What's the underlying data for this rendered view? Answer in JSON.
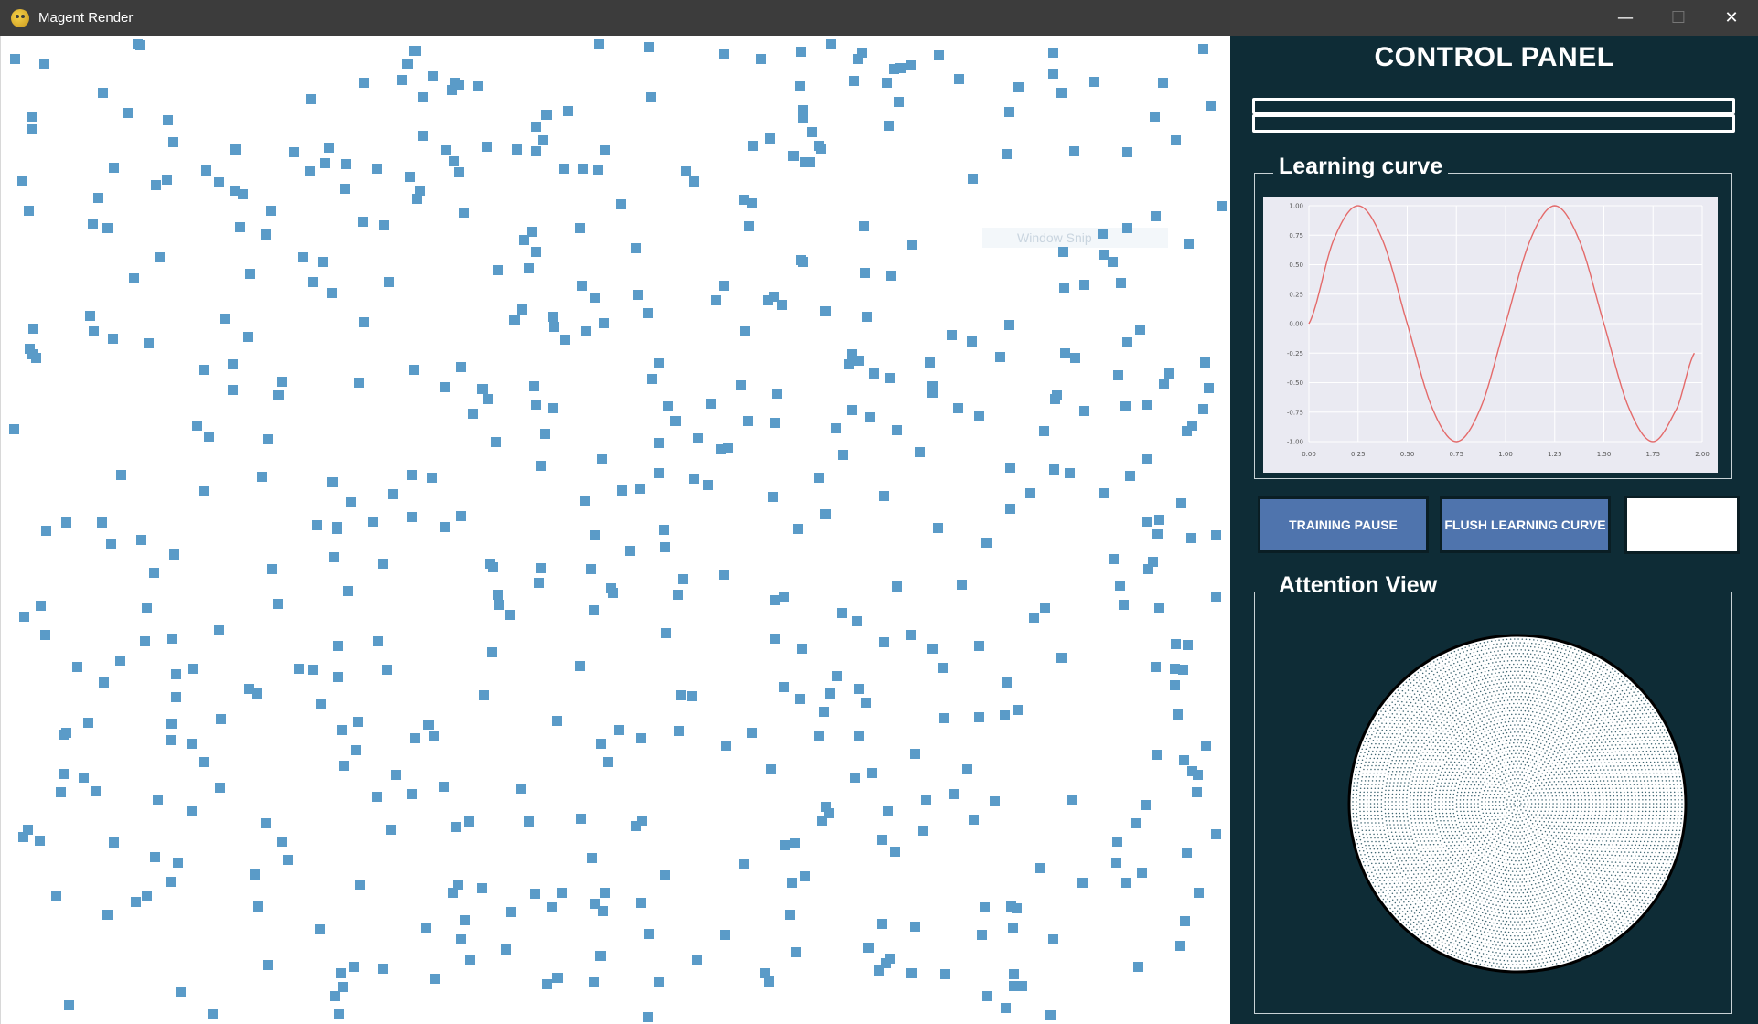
{
  "window": {
    "title": "Magent Render",
    "controls": {
      "minimize": "—",
      "maximize": "☐",
      "close": "✕"
    }
  },
  "canvas": {
    "agent_color": "#5a9bc8",
    "ghost_tooltip": "Window Snip"
  },
  "panel": {
    "title": "CONTROL PANEL",
    "background": "#0e2c36",
    "learning_curve": {
      "label": "Learning curve",
      "chart_data": {
        "type": "line",
        "title": "",
        "xlabel": "",
        "ylabel": "",
        "x": [
          0.0,
          0.125,
          0.25,
          0.375,
          0.5,
          0.625,
          0.75,
          0.875,
          1.0,
          1.125,
          1.25,
          1.375,
          1.5,
          1.625,
          1.75,
          1.875,
          1.96
        ],
        "series": [
          {
            "values": [
              0.0,
              0.707,
              1.0,
              0.707,
              0.0,
              -0.707,
              -1.0,
              -0.707,
              0.0,
              0.707,
              1.0,
              0.707,
              0.0,
              -0.707,
              -1.0,
              -0.707,
              -0.25
            ],
            "color": "#e46a6a"
          }
        ],
        "xticks": [
          "0.00",
          "0.25",
          "0.50",
          "0.75",
          "1.00",
          "1.25",
          "1.50",
          "1.75",
          "2.00"
        ],
        "yticks": [
          "1.00",
          "0.75",
          "0.50",
          "0.25",
          "0.00",
          "-0.25",
          "-0.50",
          "-0.75",
          "-1.00"
        ],
        "xlim": [
          0,
          2.0
        ],
        "ylim": [
          -1.0,
          1.0
        ],
        "grid": true,
        "plot_background": "#eaeaf2"
      }
    },
    "buttons": {
      "training_pause": "TRAINING PAUSE",
      "flush_learning_curve": "FLUSH LEARNING CURVE",
      "color": "#4f74ad"
    },
    "attention_view": {
      "label": "Attention View"
    }
  }
}
